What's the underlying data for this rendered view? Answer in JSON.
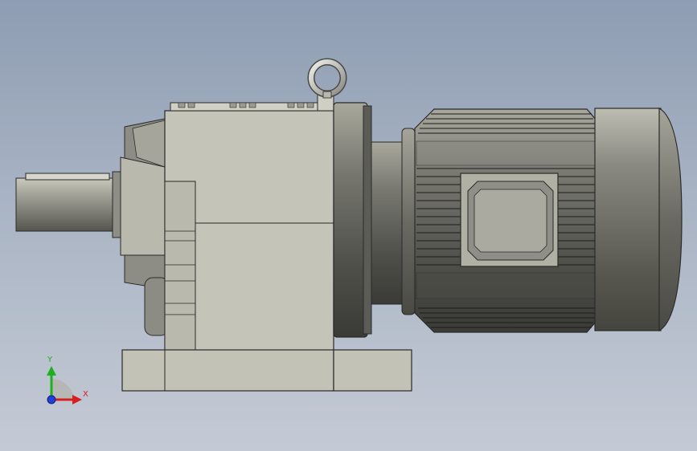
{
  "viewport": {
    "background_top": "#8e9db3",
    "background_bottom": "#c4cad5"
  },
  "triad": {
    "x_label": "X",
    "y_label": "Y",
    "x_color": "#d62020",
    "y_color": "#1fb01f",
    "z_color": "#1f3fd6"
  }
}
